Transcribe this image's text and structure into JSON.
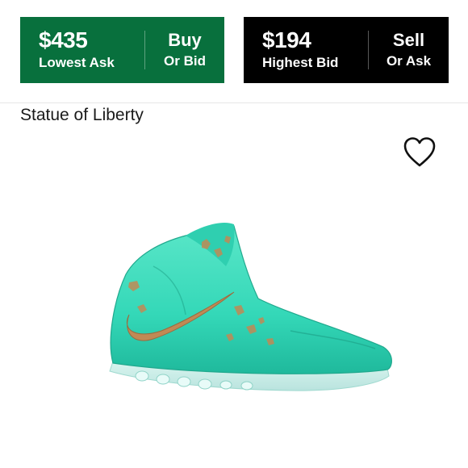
{
  "buy": {
    "price": "$435",
    "label": "Lowest Ask",
    "cta_main": "Buy",
    "cta_sub": "Or Bid",
    "color": "#08703d"
  },
  "sell": {
    "price": "$194",
    "label": "Highest Bid",
    "cta_main": "Sell",
    "cta_sub": "Or Ask",
    "color": "#000000"
  },
  "product": {
    "name": "Statue of Liberty",
    "image_icon": "sneaker-image",
    "favorite_icon": "heart-outline-icon",
    "shoe_color": "#34d8b8",
    "accent_color": "#c08a55"
  }
}
